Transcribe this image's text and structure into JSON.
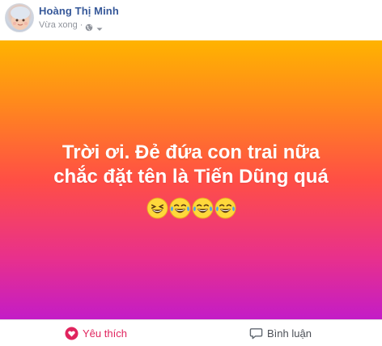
{
  "post": {
    "author": "Hoàng Thị Minh",
    "timestamp": "Vừa xong",
    "separator": "·",
    "privacy_icon": "globe-icon",
    "menu_icon": "caret-down-icon"
  },
  "content": {
    "background": {
      "top": "#ffb300",
      "middle": "#ff4f45",
      "bottom": "#c31cc7"
    },
    "text_lines": [
      "Trời ơi. Đẻ đứa con trai nữa",
      "chắc đặt tên là Tiến Dũng quá"
    ],
    "emojis": [
      "grinning-squint-emoji",
      "tears-of-joy-emoji",
      "tears-of-joy-emoji",
      "tears-of-joy-emoji"
    ]
  },
  "actions": {
    "like_label": "Yêu thích",
    "like_icon": "heart-icon",
    "like_color": "#e0245e",
    "comment_label": "Bình luận",
    "comment_icon": "comment-bubble-icon"
  }
}
